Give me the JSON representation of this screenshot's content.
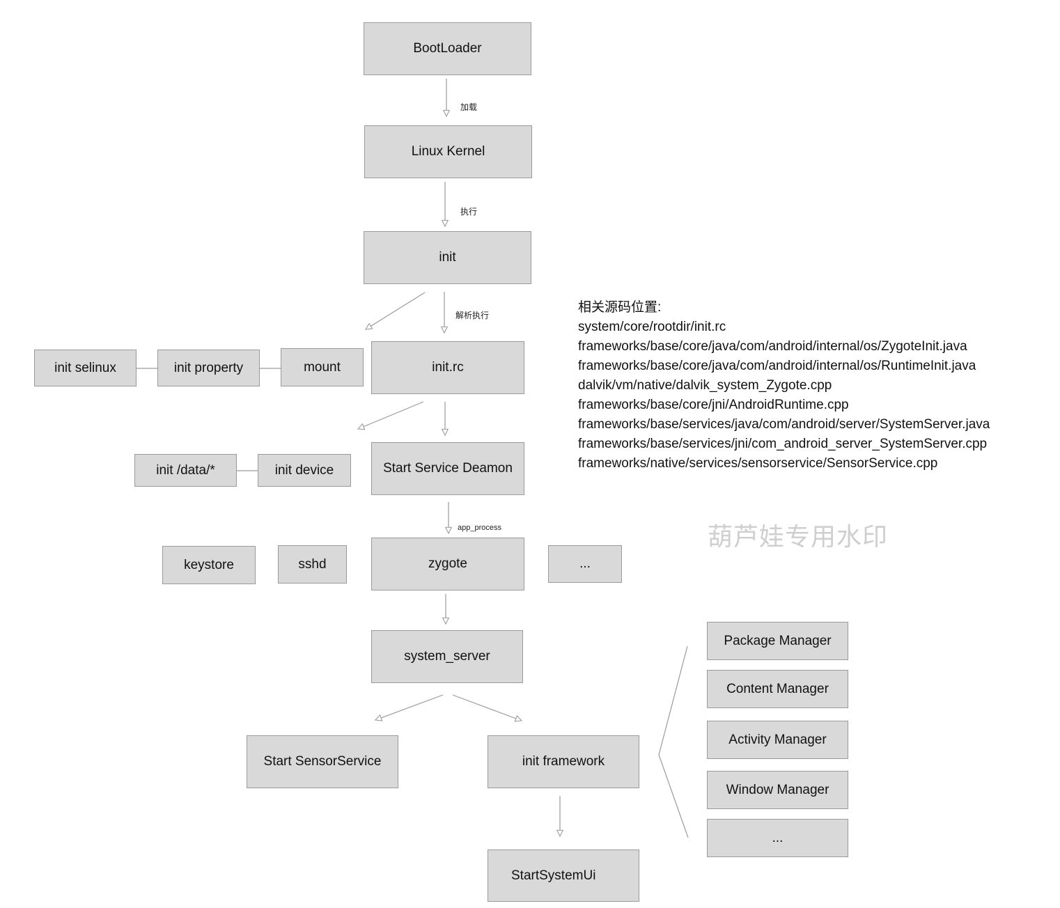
{
  "diagram": {
    "nodes": {
      "bootloader": "BootLoader",
      "linux_kernel": "Linux Kernel",
      "init": "init",
      "init_rc": "init.rc",
      "init_selinux": "init selinux",
      "init_property": "init property",
      "mount": "mount",
      "start_service_daemon": "Start Service Deamon",
      "init_data": "init /data/*",
      "init_device": "init device",
      "keystore": "keystore",
      "sshd": "sshd",
      "zygote": "zygote",
      "zygote_more": "...",
      "system_server": "system_server",
      "start_sensor_service": "Start SensorService",
      "init_framework": "init framework",
      "start_system_ui": "StartSystemUi",
      "package_manager": "Package Manager",
      "content_manager": "Content Manager",
      "activity_manager": "Activity Manager",
      "window_manager": "Window Manager",
      "managers_more": "..."
    },
    "edge_labels": {
      "load": "加载",
      "execute": "执行",
      "parse_execute": "解析执行",
      "app_process": "app_process"
    },
    "edges": [
      {
        "from": "bootloader",
        "to": "linux_kernel",
        "label": "加载"
      },
      {
        "from": "linux_kernel",
        "to": "init",
        "label": "执行"
      },
      {
        "from": "init",
        "to": "init_rc",
        "label": "解析执行"
      },
      {
        "from": "init",
        "to": "mount",
        "label": ""
      },
      {
        "from": "init_rc",
        "to": "start_service_daemon",
        "label": ""
      },
      {
        "from": "init_rc",
        "to": "init_device",
        "label": ""
      },
      {
        "from": "start_service_daemon",
        "to": "zygote",
        "label": "app_process"
      },
      {
        "from": "zygote",
        "to": "system_server",
        "label": ""
      },
      {
        "from": "system_server",
        "to": "start_sensor_service",
        "label": ""
      },
      {
        "from": "system_server",
        "to": "init_framework",
        "label": ""
      },
      {
        "from": "init_framework",
        "to": "start_system_ui",
        "label": ""
      }
    ]
  },
  "source_notes": {
    "title": "相关源码位置:",
    "paths": [
      "system/core/rootdir/init.rc",
      "frameworks/base/core/java/com/android/internal/os/ZygoteInit.java",
      "frameworks/base/core/java/com/android/internal/os/RuntimeInit.java",
      "dalvik/vm/native/dalvik_system_Zygote.cpp",
      "frameworks/base/core/jni/AndroidRuntime.cpp",
      "frameworks/base/services/java/com/android/server/SystemServer.java",
      "frameworks/base/services/jni/com_android_server_SystemServer.cpp",
      "frameworks/native/services/sensorservice/SensorService.cpp"
    ]
  },
  "watermark": "葫芦娃专用水印",
  "colors": {
    "box_fill": "#d9d9d9",
    "box_border": "#9a9a9a",
    "edge": "#9a9a9a",
    "watermark": "#cfcfcf"
  }
}
